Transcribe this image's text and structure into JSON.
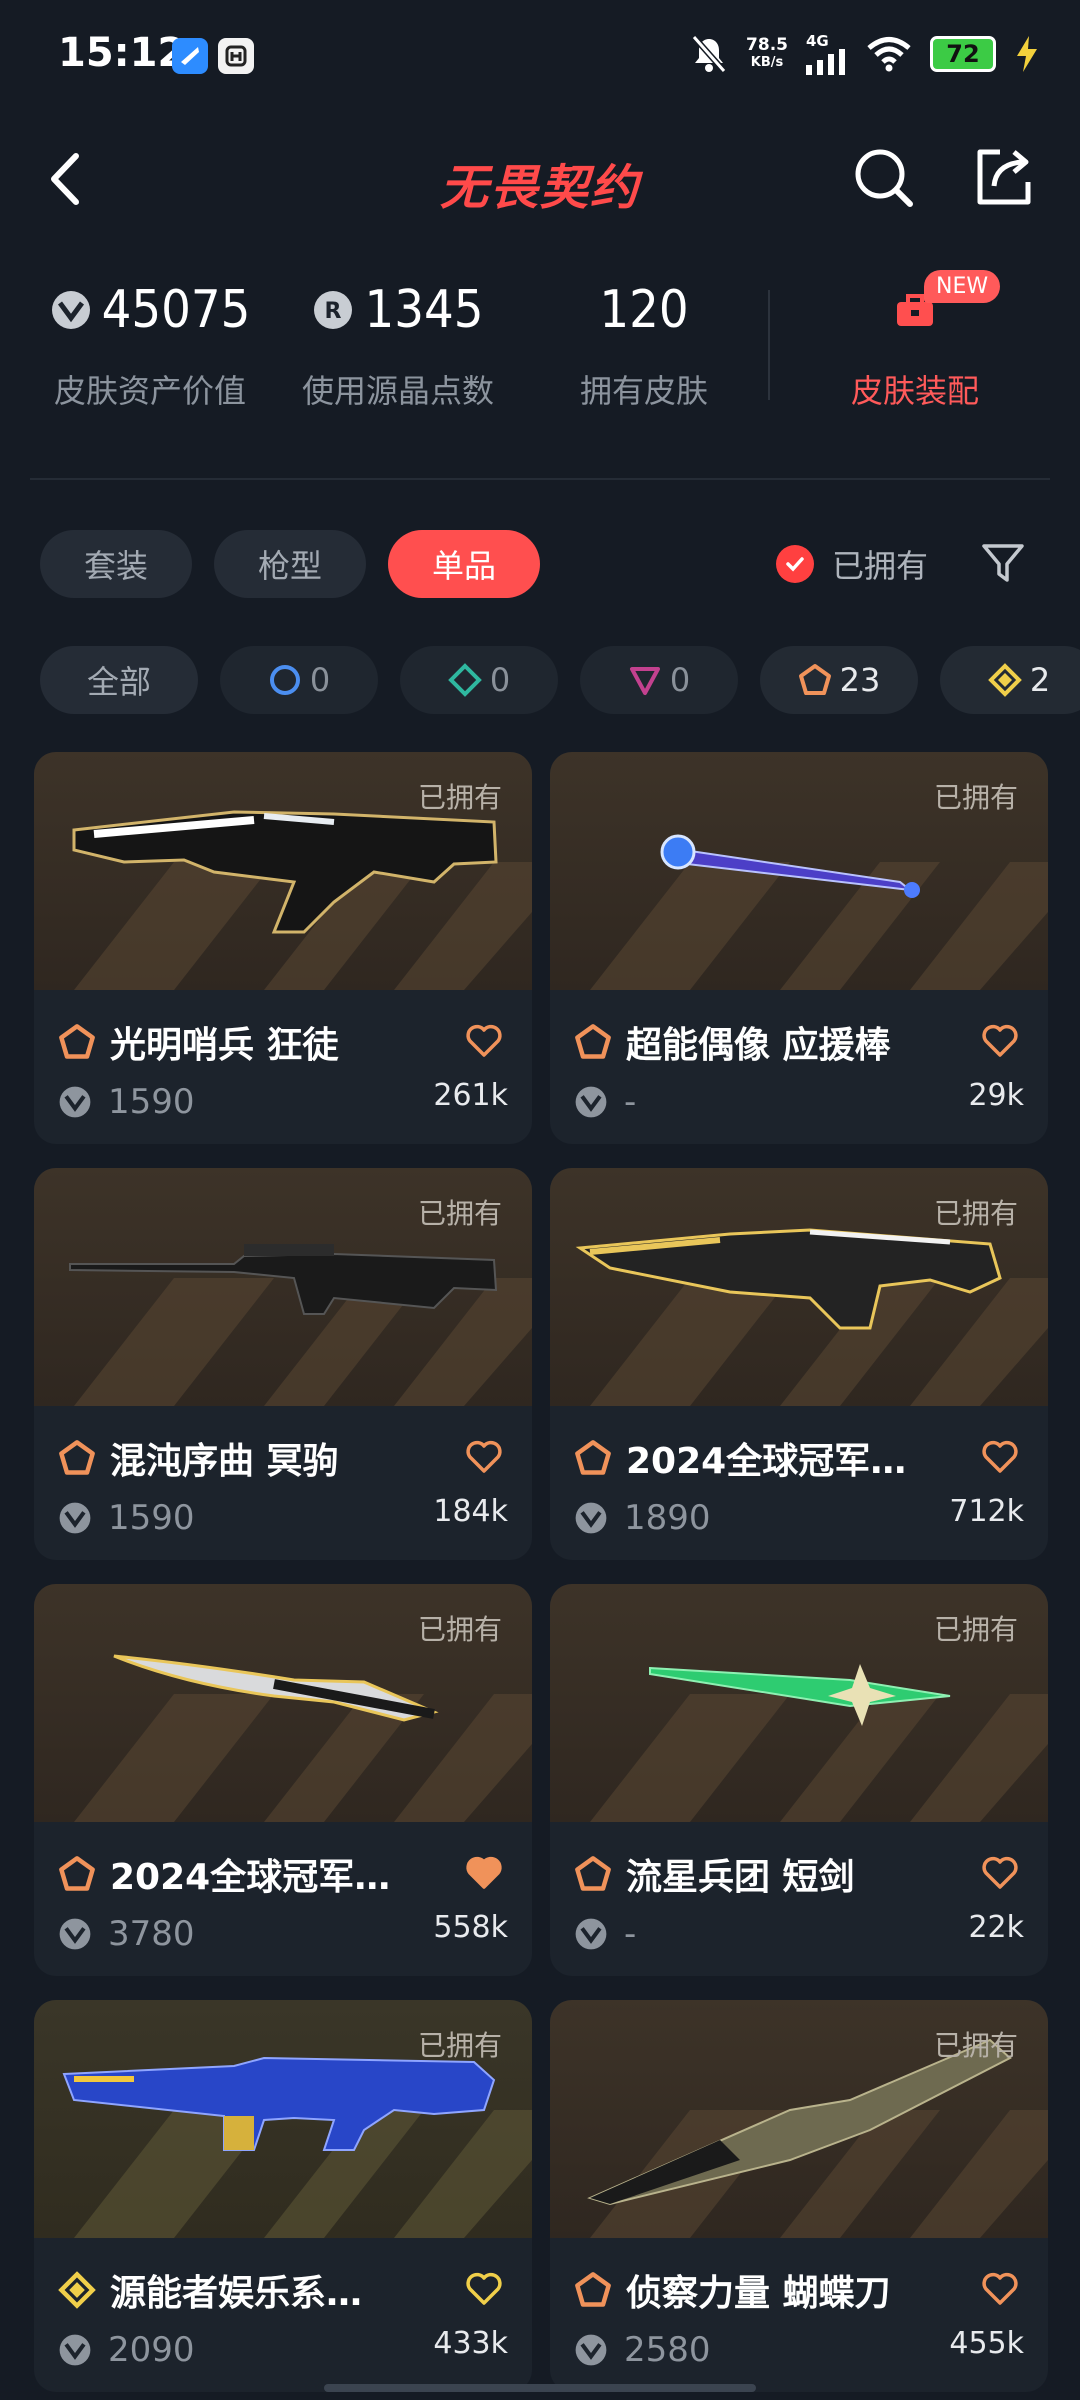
{
  "status_bar": {
    "time": "15:12",
    "speed_value": "78.5",
    "speed_unit": "KB/s",
    "network": "4G",
    "battery": "72"
  },
  "header": {
    "title": "无畏契约"
  },
  "stats": {
    "asset_value": "45075",
    "asset_value_label": "皮肤资产价值",
    "radianite": "1345",
    "radianite_label": "使用源晶点数",
    "skins_owned": "120",
    "skins_owned_label": "拥有皮肤",
    "equip_label": "皮肤装配",
    "new_badge": "NEW"
  },
  "tabs": [
    {
      "label": "套装"
    },
    {
      "label": "枪型"
    },
    {
      "label": "单品"
    }
  ],
  "owned_filter": {
    "label": "已拥有"
  },
  "chips": {
    "all": "全部",
    "select": "0",
    "deluxe": "0",
    "premium": "0",
    "exclusive": "23",
    "ultra": "2"
  },
  "colors": {
    "accent": "#ff4f4f",
    "background": "#151b24",
    "card": "#1c232c",
    "exclusive_tier": "#f0925a",
    "ultra_tier": "#f0cf4a"
  },
  "cards": [
    {
      "owned": "已拥有",
      "title": "光明哨兵 狂徒",
      "price": "1590",
      "likes": "261k"
    },
    {
      "owned": "已拥有",
      "title": "超能偶像 应援棒",
      "price": "-",
      "likes": "29k"
    },
    {
      "owned": "已拥有",
      "title": "混沌序曲 冥驹",
      "price": "1590",
      "likes": "184k"
    },
    {
      "owned": "已拥有",
      "title": "2024全球冠军…",
      "price": "1890",
      "likes": "712k"
    },
    {
      "owned": "已拥有",
      "title": "2024全球冠军…",
      "price": "3780",
      "likes": "558k"
    },
    {
      "owned": "已拥有",
      "title": "流星兵团 短剑",
      "price": "-",
      "likes": "22k"
    },
    {
      "owned": "已拥有",
      "title": "源能者娱乐系…",
      "price": "2090",
      "likes": "433k"
    },
    {
      "owned": "已拥有",
      "title": "侦察力量 蝴蝶刀",
      "price": "2580",
      "likes": "455k"
    }
  ]
}
